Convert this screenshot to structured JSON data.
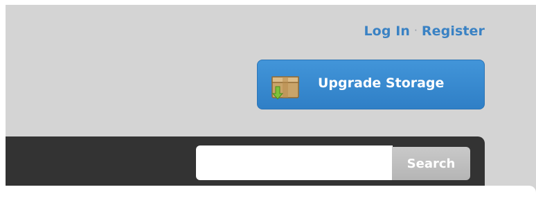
{
  "header": {
    "login_label": "Log In",
    "separator": "·",
    "register_label": "Register"
  },
  "upgrade": {
    "label": "Upgrade Storage",
    "icon": "box-download-icon"
  },
  "search": {
    "value": "",
    "placeholder": "",
    "button_label": "Search"
  },
  "colors": {
    "link": "#3a82c4",
    "upgrade_button": "#3a8ad0",
    "nav_bar": "#333333",
    "search_button": "#bdbdbd",
    "page_background": "#d4d4d4"
  }
}
